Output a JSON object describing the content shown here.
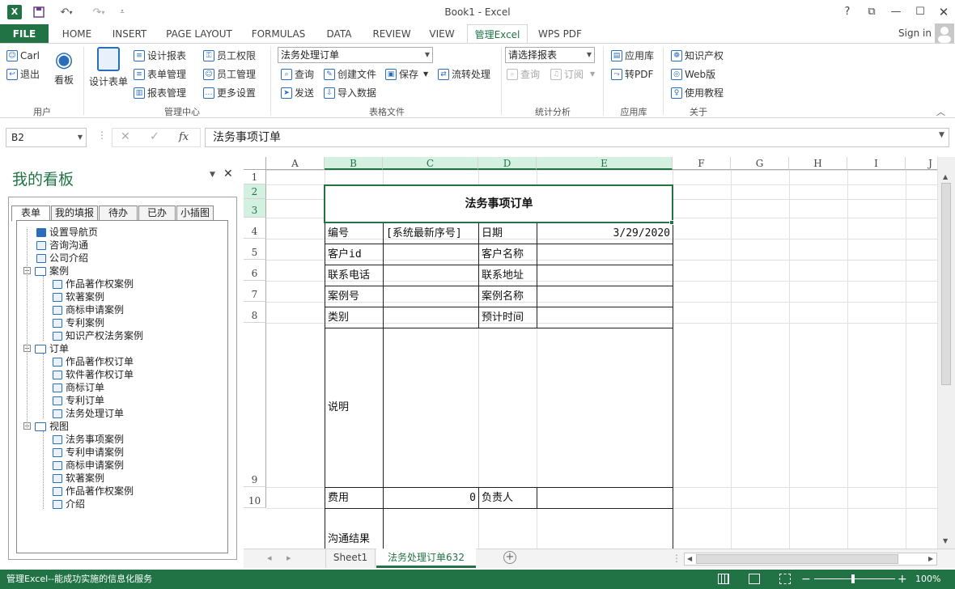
{
  "window": {
    "title": "Book1 - Excel",
    "help": "?",
    "signin": "Sign in"
  },
  "tabs": [
    "FILE",
    "HOME",
    "INSERT",
    "PAGE LAYOUT",
    "FORMULAS",
    "DATA",
    "REVIEW",
    "VIEW",
    "管理Excel",
    "WPS PDF"
  ],
  "ribbon": {
    "user": {
      "carl": "Carl",
      "logout": "退出",
      "board": "看板",
      "group": "用户"
    },
    "mgmt": {
      "design_form": "设计表单",
      "design_report": "设计报表",
      "form_mgmt": "表单管理",
      "report_mgmt": "报表管理",
      "emp_perm": "员工权限",
      "emp_mgmt": "员工管理",
      "more_settings": "更多设置",
      "group": "管理中心"
    },
    "tablefile": {
      "combo": "法务处理订单",
      "query": "查询",
      "create": "创建文件",
      "save": "保存",
      "flow": "流转处理",
      "send": "发送",
      "import": "导入数据",
      "group": "表格文件"
    },
    "stats": {
      "combo": "请选择报表",
      "query": "查询",
      "subscribe": "订阅",
      "group": "统计分析"
    },
    "apps": {
      "applib": "应用库",
      "topdf": "转PDF",
      "group": "应用库"
    },
    "about": {
      "ip": "知识产权",
      "web": "Web版",
      "tutorial": "使用教程",
      "group": "关于"
    }
  },
  "formula_bar": {
    "namebox": "B2",
    "fx": "fx",
    "content": "法务事项订单"
  },
  "pane": {
    "title": "我的看板",
    "tabs": [
      "表单",
      "我的填报",
      "待办",
      "已办",
      "小插图"
    ],
    "tree": [
      {
        "label": "设置导航页",
        "level": 1,
        "icon": "nav"
      },
      {
        "label": "咨询沟通",
        "level": 1,
        "icon": "doc"
      },
      {
        "label": "公司介绍",
        "level": 1,
        "icon": "doc"
      },
      {
        "label": "案例",
        "level": 0,
        "icon": "folder"
      },
      {
        "label": "作品著作权案例",
        "level": 2,
        "icon": "doc"
      },
      {
        "label": "软著案例",
        "level": 2,
        "icon": "doc"
      },
      {
        "label": "商标申请案例",
        "level": 2,
        "icon": "doc"
      },
      {
        "label": "专利案例",
        "level": 2,
        "icon": "doc"
      },
      {
        "label": "知识产权法务案例",
        "level": 2,
        "icon": "doc"
      },
      {
        "label": "订单",
        "level": 0,
        "icon": "folder"
      },
      {
        "label": "作品著作权订单",
        "level": 2,
        "icon": "doc"
      },
      {
        "label": "软件著作权订单",
        "level": 2,
        "icon": "doc"
      },
      {
        "label": "商标订单",
        "level": 2,
        "icon": "doc"
      },
      {
        "label": "专利订单",
        "level": 2,
        "icon": "doc"
      },
      {
        "label": "法务处理订单",
        "level": 2,
        "icon": "doc"
      },
      {
        "label": "视图",
        "level": 0,
        "icon": "folder"
      },
      {
        "label": "法务事项案例",
        "level": 2,
        "icon": "view"
      },
      {
        "label": "专利申请案例",
        "level": 2,
        "icon": "view"
      },
      {
        "label": "商标申请案例",
        "level": 2,
        "icon": "view"
      },
      {
        "label": "软著案例",
        "level": 2,
        "icon": "view"
      },
      {
        "label": "作品著作权案例",
        "level": 2,
        "icon": "view"
      },
      {
        "label": "介绍",
        "level": 2,
        "icon": "view"
      }
    ]
  },
  "sheet": {
    "columns": [
      "A",
      "B",
      "C",
      "D",
      "E",
      "F",
      "G",
      "H",
      "I",
      "J"
    ],
    "rows": [
      "1",
      "2",
      "3",
      "4",
      "5",
      "6",
      "7",
      "8",
      "9",
      "10"
    ],
    "form": {
      "title": "法务事项订单",
      "b4": "编号",
      "c4": "[系统最新序号]",
      "d4": "日期",
      "e4": "3/29/2020",
      "b5": "客户id",
      "d5": "客户名称",
      "b6": "联系电话",
      "d6": "联系地址",
      "b7": "案例号",
      "d7": "案例名称",
      "b8": "类别",
      "d8": "预计时间",
      "b9": "说明",
      "b10": "费用",
      "c10": "0",
      "d10": "负责人",
      "b11": "沟通结果"
    }
  },
  "sheet_tabs": [
    "Sheet1",
    "法务处理订单632"
  ],
  "status": {
    "text": "管理Excel--能成功实施的信息化服务",
    "zoom": "100%"
  }
}
